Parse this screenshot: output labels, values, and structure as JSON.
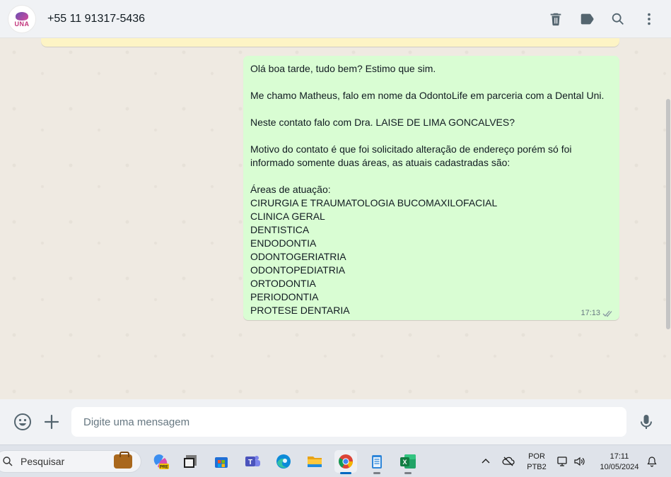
{
  "header": {
    "avatar_logo_text": "UNA",
    "contact_name": "+55 11 91317-5436",
    "actions": [
      "delete-icon",
      "label-icon",
      "search-icon",
      "menu-icon"
    ]
  },
  "message": {
    "lines": [
      "Olá boa tarde, tudo bem? Estimo que sim.",
      "",
      "Me chamo Matheus, falo em nome da OdontoLife em parceria com a Dental Uni.",
      "",
      "Neste contato falo com Dra. LAISE DE LIMA GONCALVES?",
      "",
      "Motivo do contato é que foi solicitado alteração de endereço porém só foi",
      "informado somente duas áreas, as atuais cadastradas são:",
      "",
      "Áreas de atuação:",
      "CIRURGIA E TRAUMATOLOGIA BUCOMAXILOFACIAL",
      "CLINICA GERAL",
      "DENTISTICA",
      "ENDODONTIA",
      "ODONTOGERIATRIA",
      "ODONTOPEDIATRIA",
      "ORTODONTIA",
      "PERIODONTIA",
      "PROTESE DENTARIA"
    ],
    "time": "17:13",
    "status_icon": "double-check-icon"
  },
  "composer": {
    "placeholder": "Digite uma mensagem",
    "value": ""
  },
  "taskbar": {
    "search_label": "Pesquisar",
    "apps": [
      "copilot-pre-icon",
      "window-app-icon",
      "microsoft-store-icon",
      "teams-icon",
      "edge-icon",
      "file-explorer-icon",
      "chrome-icon",
      "notepad-icon",
      "excel-icon"
    ],
    "copilot_badge": "PRE",
    "teams_letter": "T",
    "excel_letter": "X",
    "language_line1": "POR",
    "language_line2": "PTB2",
    "time": "17:11",
    "date": "10/05/2024"
  },
  "colors": {
    "chat_background": "#efeae2",
    "outgoing_bubble": "#d9fdd3",
    "header_background": "#f0f2f5",
    "icon_gray": "#54656f",
    "read_receipt": "#8696a0"
  }
}
